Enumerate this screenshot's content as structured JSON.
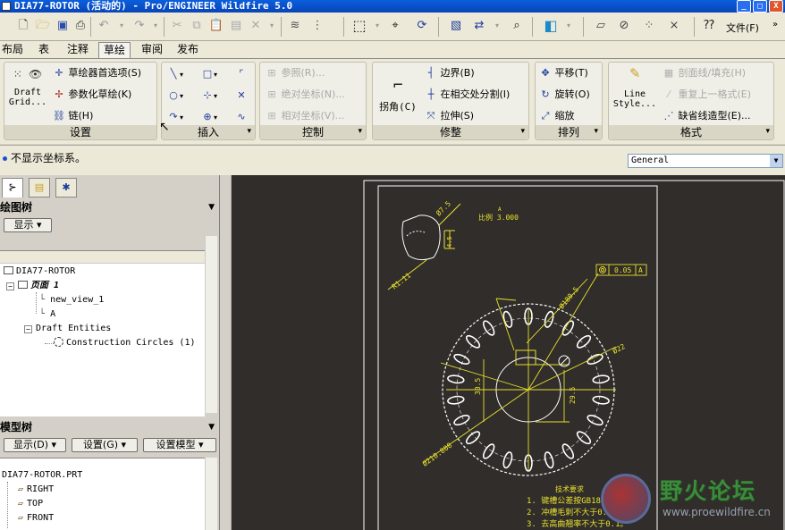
{
  "window": {
    "title": "DIA77-ROTOR (活动的) - Pro/ENGINEER Wildfire 5.0",
    "min": "_",
    "max": "□",
    "close": "X"
  },
  "menu": {
    "file_label": "文件(F)"
  },
  "tabs": [
    "布局",
    "表",
    "注释",
    "草绘",
    "审阅",
    "发布"
  ],
  "active_tab": "草绘",
  "ribbon": {
    "settings": {
      "title": "设置",
      "draft_grid": "Draft Grid...",
      "items": [
        "草绘器首选项(S)",
        "参数化草绘(K)",
        "链(H)"
      ]
    },
    "insert": {
      "title": "插入"
    },
    "control": {
      "title": "控制",
      "items": [
        "参照(R)...",
        "绝对坐标(N)...",
        "相对坐标(V)..."
      ]
    },
    "modify": {
      "title": "修整",
      "corner": "拐角(C)",
      "items": [
        "边界(B)",
        "在相交处分割(I)",
        "拉伸(S)"
      ]
    },
    "arrange": {
      "title": "排列",
      "items": [
        "平移(T)",
        "旋转(O)",
        "缩放"
      ]
    },
    "format": {
      "title": "格式",
      "line_style": "Line Style...",
      "items": [
        "剖面线/填充(H)",
        "重复上一格式(E)",
        "缺省线造型(E)..."
      ]
    }
  },
  "message": "不显示坐标系。",
  "filter_value": "General",
  "left_panel": {
    "drawing_tree": {
      "title": "绘图树",
      "show_btn": "显示 ▾",
      "nodes": [
        "DIA77-ROTOR",
        "页面 1",
        "new_view_1",
        "A",
        "Draft Entities",
        "Construction Circles (1)"
      ]
    },
    "model_tree": {
      "title": "模型树",
      "buttons": [
        "显示(D) ▾",
        "设置(G) ▾",
        "设置模型 ▾"
      ],
      "nodes": [
        "DIA77-ROTOR.PRT",
        "RIGHT",
        "TOP",
        "FRONT"
      ]
    }
  },
  "drawing": {
    "dim_a": "Ø7.5",
    "dim_b": "4.5",
    "ref_r": "R1.11",
    "a_label": "A",
    "scale_note": "比例 3.000",
    "dim_d1": "Ø180.5",
    "gtol": "0.05",
    "gtol_datum": "A",
    "dim_d2": "Ø22",
    "dim_d3": "Ø210.808",
    "dim_h1": "30.5",
    "dim_h2": "29.5",
    "notes_title": "技术要求",
    "notes": [
      "1. 键槽公差按GB1800-79H10",
      "2. 冲槽毛刺不大于0.05。",
      "3. 去高曲翘率不大于0.1。"
    ]
  },
  "watermark": {
    "text": "野火论坛",
    "url": "www.proewildfire.cn"
  }
}
